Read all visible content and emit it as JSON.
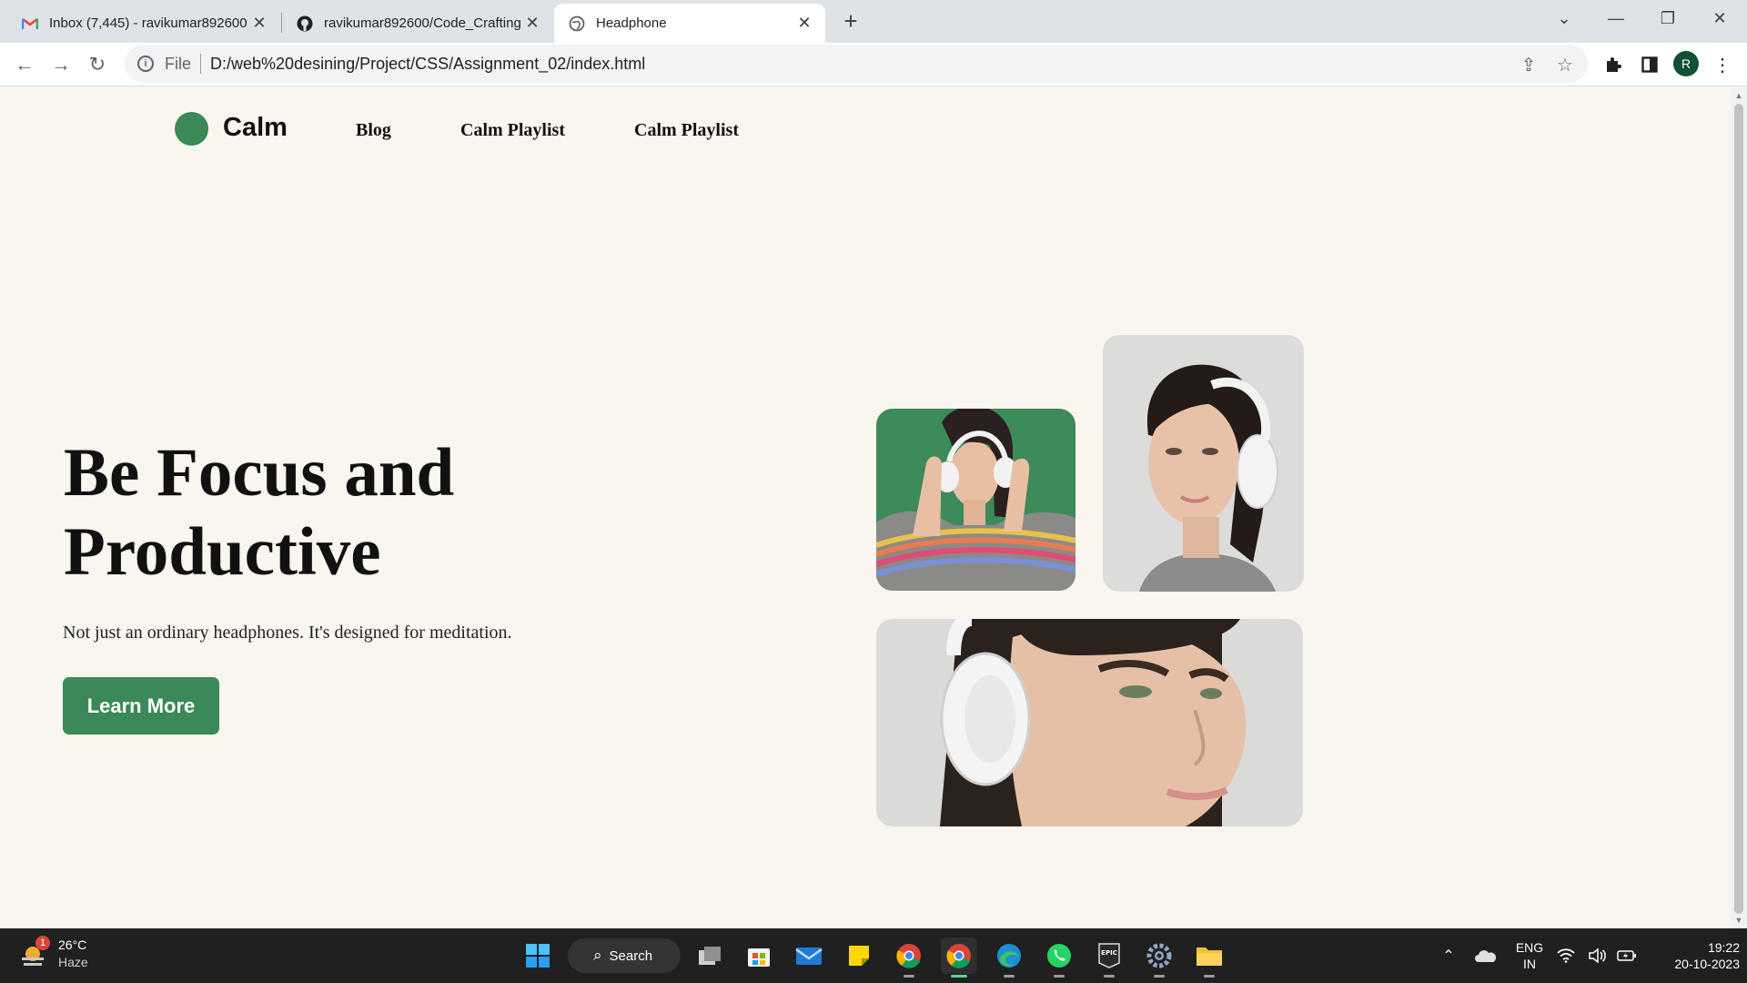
{
  "browser": {
    "tabs": [
      {
        "title": "Inbox (7,445) - ravikumar892600",
        "icon": "gmail-icon",
        "active": false
      },
      {
        "title": "ravikumar892600/Code_Crafting",
        "icon": "github-icon",
        "active": false
      },
      {
        "title": "Headphone",
        "icon": "globe-icon",
        "active": true
      }
    ],
    "address": {
      "scheme": "File",
      "url": "D:/web%20desining/Project/CSS/Assignment_02/index.html"
    },
    "profile_initial": "R"
  },
  "site": {
    "logo_text": "Calm",
    "nav": [
      "Blog",
      "Calm Playlist",
      "Calm Playlist"
    ],
    "hero_title_line1": "Be Focus and",
    "hero_title_line2": "Productive",
    "hero_subtitle": "Not just an ordinary headphones. It's designed for meditation.",
    "cta_label": "Learn More",
    "accent_color": "#3b8858",
    "background_color": "#f9f5ef"
  },
  "taskbar": {
    "weather_temp": "26°C",
    "weather_desc": "Haze",
    "weather_badge": "1",
    "search_label": "Search",
    "lang_line1": "ENG",
    "lang_line2": "IN",
    "time": "19:22",
    "date": "20-10-2023"
  }
}
